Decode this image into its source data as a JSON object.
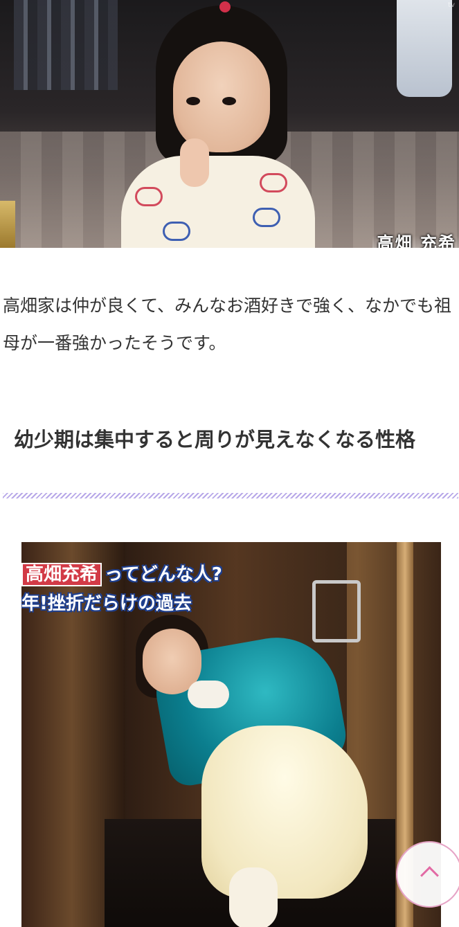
{
  "top_photo": {
    "overlay_text": "高畑 充希",
    "logo_text": "tv"
  },
  "article": {
    "paragraph": "高畑家は仲が良くて、みんなお酒好きで強く、なかでも祖母が一番強かったそうです。",
    "heading": "幼少期は集中すると周りが見えなくなる性格"
  },
  "bottom_photo": {
    "tv_name_box": "高畑充希",
    "tv_line1_rest": "ってどんな人?",
    "tv_line2": "年!挫折だらけの過去"
  },
  "scroll_top": {
    "icon": "chevron-up-icon"
  },
  "colors": {
    "accent": "#e26aa4",
    "heading_rule": "#b7a7e8",
    "text": "#333333"
  }
}
